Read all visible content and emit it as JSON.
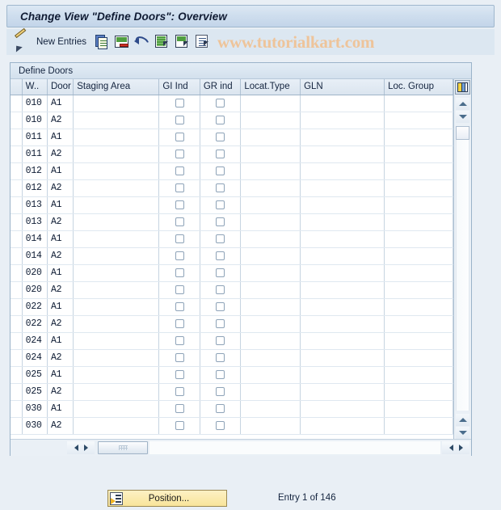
{
  "window": {
    "title": "Change View \"Define Doors\": Overview"
  },
  "toolbar": {
    "icons": [
      {
        "name": "display-change-pencil-icon"
      },
      {
        "name": "copy-icon"
      },
      {
        "name": "delete-row-icon"
      },
      {
        "name": "undo-icon"
      },
      {
        "name": "select-all-icon"
      },
      {
        "name": "deselect-all-icon"
      },
      {
        "name": "select-block-icon"
      }
    ],
    "new_entries_label": "New Entries",
    "watermark": "www.tutorialkart.com"
  },
  "panel": {
    "title": "Define Doors"
  },
  "table": {
    "columns": [
      {
        "key": "wh",
        "label": "W.."
      },
      {
        "key": "door",
        "label": "Door"
      },
      {
        "key": "staging",
        "label": "Staging Area"
      },
      {
        "key": "gi",
        "label": "GI Ind"
      },
      {
        "key": "gr",
        "label": "GR ind"
      },
      {
        "key": "locattype",
        "label": "Locat.Type"
      },
      {
        "key": "gln",
        "label": "GLN"
      },
      {
        "key": "locgroup",
        "label": "Loc. Group"
      }
    ],
    "config_icon": "grid-settings-icon",
    "rows": [
      {
        "wh": "010",
        "door": "A1",
        "staging": "",
        "gi": false,
        "gr": false,
        "locattype": "",
        "gln": "",
        "locgroup": ""
      },
      {
        "wh": "010",
        "door": "A2",
        "staging": "",
        "gi": false,
        "gr": false,
        "locattype": "",
        "gln": "",
        "locgroup": ""
      },
      {
        "wh": "011",
        "door": "A1",
        "staging": "",
        "gi": false,
        "gr": false,
        "locattype": "",
        "gln": "",
        "locgroup": ""
      },
      {
        "wh": "011",
        "door": "A2",
        "staging": "",
        "gi": false,
        "gr": false,
        "locattype": "",
        "gln": "",
        "locgroup": ""
      },
      {
        "wh": "012",
        "door": "A1",
        "staging": "",
        "gi": false,
        "gr": false,
        "locattype": "",
        "gln": "",
        "locgroup": ""
      },
      {
        "wh": "012",
        "door": "A2",
        "staging": "",
        "gi": false,
        "gr": false,
        "locattype": "",
        "gln": "",
        "locgroup": ""
      },
      {
        "wh": "013",
        "door": "A1",
        "staging": "",
        "gi": false,
        "gr": false,
        "locattype": "",
        "gln": "",
        "locgroup": ""
      },
      {
        "wh": "013",
        "door": "A2",
        "staging": "",
        "gi": false,
        "gr": false,
        "locattype": "",
        "gln": "",
        "locgroup": ""
      },
      {
        "wh": "014",
        "door": "A1",
        "staging": "",
        "gi": false,
        "gr": false,
        "locattype": "",
        "gln": "",
        "locgroup": ""
      },
      {
        "wh": "014",
        "door": "A2",
        "staging": "",
        "gi": false,
        "gr": false,
        "locattype": "",
        "gln": "",
        "locgroup": ""
      },
      {
        "wh": "020",
        "door": "A1",
        "staging": "",
        "gi": false,
        "gr": false,
        "locattype": "",
        "gln": "",
        "locgroup": ""
      },
      {
        "wh": "020",
        "door": "A2",
        "staging": "",
        "gi": false,
        "gr": false,
        "locattype": "",
        "gln": "",
        "locgroup": ""
      },
      {
        "wh": "022",
        "door": "A1",
        "staging": "",
        "gi": false,
        "gr": false,
        "locattype": "",
        "gln": "",
        "locgroup": ""
      },
      {
        "wh": "022",
        "door": "A2",
        "staging": "",
        "gi": false,
        "gr": false,
        "locattype": "",
        "gln": "",
        "locgroup": ""
      },
      {
        "wh": "024",
        "door": "A1",
        "staging": "",
        "gi": false,
        "gr": false,
        "locattype": "",
        "gln": "",
        "locgroup": ""
      },
      {
        "wh": "024",
        "door": "A2",
        "staging": "",
        "gi": false,
        "gr": false,
        "locattype": "",
        "gln": "",
        "locgroup": ""
      },
      {
        "wh": "025",
        "door": "A1",
        "staging": "",
        "gi": false,
        "gr": false,
        "locattype": "",
        "gln": "",
        "locgroup": ""
      },
      {
        "wh": "025",
        "door": "A2",
        "staging": "",
        "gi": false,
        "gr": false,
        "locattype": "",
        "gln": "",
        "locgroup": ""
      },
      {
        "wh": "030",
        "door": "A1",
        "staging": "",
        "gi": false,
        "gr": false,
        "locattype": "",
        "gln": "",
        "locgroup": ""
      },
      {
        "wh": "030",
        "door": "A2",
        "staging": "",
        "gi": false,
        "gr": false,
        "locattype": "",
        "gln": "",
        "locgroup": ""
      }
    ]
  },
  "footer": {
    "position_button": "Position...",
    "entry_status": "Entry 1 of 146"
  },
  "colors": {
    "title_text": "#101b33",
    "watermark": "#eec49a",
    "key_cell_bg": "#e2ecf5",
    "button_yellow": "#f8e49a"
  }
}
